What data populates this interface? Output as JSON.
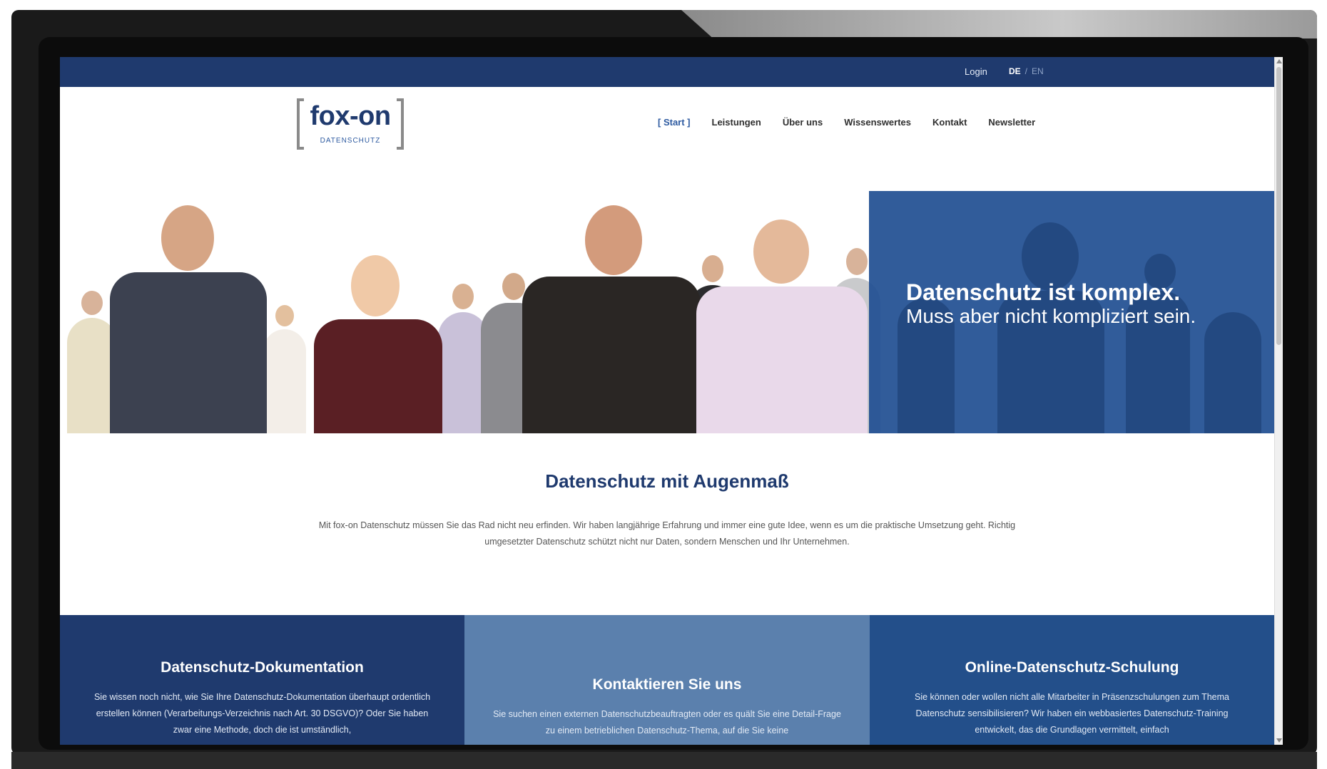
{
  "topbar": {
    "login": "Login",
    "lang_active": "DE",
    "lang_separator": "/",
    "lang_other": "EN"
  },
  "logo": {
    "word": "fox-on",
    "sub": "DATENSCHUTZ"
  },
  "nav": {
    "items": [
      "[ Start ]",
      "Leistungen",
      "Über uns",
      "Wissenswertes",
      "Kontakt",
      "Newsletter"
    ]
  },
  "hero": {
    "headline": "Datenschutz ist komplex.",
    "subline": "Muss aber nicht kompliziert sein."
  },
  "intro": {
    "title": "Datenschutz mit Augenmaß",
    "text": "Mit fox-on Datenschutz müssen Sie das Rad nicht neu erfinden. Wir haben langjährige Erfahrung und immer eine gute Idee, wenn es um die praktische Umsetzung geht. Richtig umgesetzter Datenschutz schützt nicht nur Daten, sondern Menschen und Ihr Unternehmen."
  },
  "features": [
    {
      "title": "Datenschutz-Dokumentation",
      "text": "Sie wissen noch nicht, wie Sie Ihre Datenschutz-Dokumentation überhaupt ordentlich erstellen können (Verarbeitungs-Verzeichnis nach Art. 30 DSGVO)? Oder Sie haben zwar eine Methode, doch die ist umständlich,"
    },
    {
      "title": "Kontaktieren Sie uns",
      "text": "Sie suchen einen externen Datenschutzbeauftragten oder es quält Sie eine Detail-Frage zu einem betrieblichen Datenschutz-Thema, auf die Sie keine"
    },
    {
      "title": "Online-Datenschutz-Schulung",
      "text": "Sie können oder wollen nicht alle Mitarbeiter in Präsenzschulungen zum Thema Datenschutz sensibilisieren? Wir haben ein webbasiertes Datenschutz-Training entwickelt, das die Grundlagen vermittelt, einfach"
    }
  ],
  "colors": {
    "brand_dark": "#1f3a6e",
    "brand_mid": "#5b80ad",
    "brand_blue": "#234f8a"
  }
}
